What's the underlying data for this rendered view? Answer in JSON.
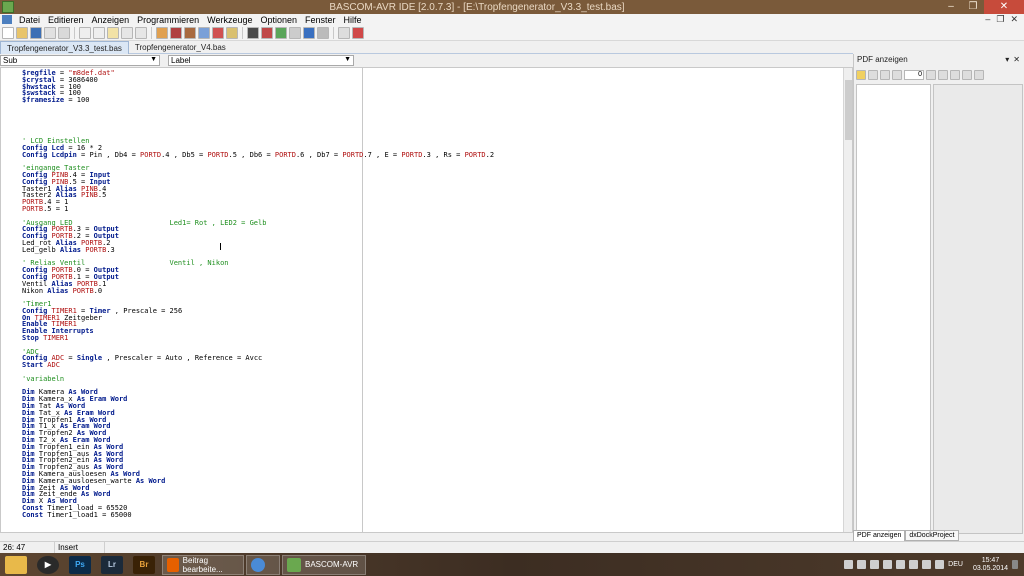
{
  "window": {
    "title": "BASCOM-AVR IDE [2.0.7.3] - [E:\\Tropfengenerator_V3.3_test.bas]",
    "controls": [
      "–",
      "❐",
      "✕"
    ]
  },
  "menu": {
    "items": [
      "Datei",
      "Editieren",
      "Anzeigen",
      "Programmieren",
      "Werkzeuge",
      "Optionen",
      "Fenster",
      "Hilfe"
    ],
    "mdi_controls": [
      "–",
      "❐",
      "✕"
    ]
  },
  "tabs": [
    "Tropfengenerator_V3.3_test.bas",
    "Tropfengenerator_V4.bas"
  ],
  "sub_combo": {
    "label": "Sub"
  },
  "label_combo": {
    "label": "Label"
  },
  "code_lines": [
    [
      [
        "kw",
        "$regfile"
      ],
      [
        "tx",
        " = "
      ],
      [
        "id",
        "\"m8def.dat\""
      ]
    ],
    [
      [
        "kw",
        "$crystal"
      ],
      [
        "tx",
        " = 3686400"
      ]
    ],
    [
      [
        "kw",
        "$hwstack"
      ],
      [
        "tx",
        " = 100"
      ]
    ],
    [
      [
        "kw",
        "$swstack"
      ],
      [
        "tx",
        " = 100"
      ]
    ],
    [
      [
        "kw",
        "$framesize"
      ],
      [
        "tx",
        " = 100"
      ]
    ],
    [],
    [],
    [],
    [],
    [],
    [
      [
        "cm",
        "' LCD Einstellen"
      ]
    ],
    [
      [
        "kw",
        "Config Lcd"
      ],
      [
        "tx",
        " = 16 * 2"
      ]
    ],
    [
      [
        "kw",
        "Config Lcdpin"
      ],
      [
        "tx",
        " = Pin , Db4 = "
      ],
      [
        "id",
        "PORTD"
      ],
      [
        "tx",
        ".4 , Db5 = "
      ],
      [
        "id",
        "PORTD"
      ],
      [
        "tx",
        ".5 , Db6 = "
      ],
      [
        "id",
        "PORTD"
      ],
      [
        "tx",
        ".6 , Db7 = "
      ],
      [
        "id",
        "PORTD"
      ],
      [
        "tx",
        ".7 , E = "
      ],
      [
        "id",
        "PORTD"
      ],
      [
        "tx",
        ".3 , Rs = "
      ],
      [
        "id",
        "PORTD"
      ],
      [
        "tx",
        ".2"
      ]
    ],
    [],
    [
      [
        "cm",
        "'eingange Taster"
      ]
    ],
    [
      [
        "kw",
        "Config"
      ],
      [
        "tx",
        " "
      ],
      [
        "id",
        "PINB"
      ],
      [
        "tx",
        ".4 = "
      ],
      [
        "kw",
        "Input"
      ]
    ],
    [
      [
        "kw",
        "Config"
      ],
      [
        "tx",
        " "
      ],
      [
        "id",
        "PINB"
      ],
      [
        "tx",
        ".5 = "
      ],
      [
        "kw",
        "Input"
      ]
    ],
    [
      [
        "tx",
        "Taster1 "
      ],
      [
        "kw",
        "Alias"
      ],
      [
        "tx",
        " "
      ],
      [
        "id",
        "PINB"
      ],
      [
        "tx",
        ".4"
      ]
    ],
    [
      [
        "tx",
        "Taster2 "
      ],
      [
        "kw",
        "Alias"
      ],
      [
        "tx",
        " "
      ],
      [
        "id",
        "PINB"
      ],
      [
        "tx",
        ".5"
      ]
    ],
    [
      [
        "id",
        "PORTB"
      ],
      [
        "tx",
        ".4 = 1"
      ]
    ],
    [
      [
        "id",
        "PORTB"
      ],
      [
        "tx",
        ".5 = 1"
      ]
    ],
    [],
    [
      [
        "cm",
        "'Ausgang LED                       Led1= Rot , LED2 = Gelb"
      ]
    ],
    [
      [
        "kw",
        "Config"
      ],
      [
        "tx",
        " "
      ],
      [
        "id",
        "PORTB"
      ],
      [
        "tx",
        ".3 = "
      ],
      [
        "kw",
        "Output"
      ]
    ],
    [
      [
        "kw",
        "Config"
      ],
      [
        "tx",
        " "
      ],
      [
        "id",
        "PORTB"
      ],
      [
        "tx",
        ".2 = "
      ],
      [
        "kw",
        "Output"
      ]
    ],
    [
      [
        "tx",
        "Led_rot "
      ],
      [
        "kw",
        "Alias"
      ],
      [
        "tx",
        " "
      ],
      [
        "id",
        "PORTB"
      ],
      [
        "tx",
        ".2"
      ]
    ],
    [
      [
        "tx",
        "Led_gelb "
      ],
      [
        "kw",
        "Alias"
      ],
      [
        "tx",
        " "
      ],
      [
        "id",
        "PORTB"
      ],
      [
        "tx",
        ".3"
      ]
    ],
    [],
    [
      [
        "cm",
        "' Relias Ventil                    Ventil , Nikon"
      ]
    ],
    [
      [
        "kw",
        "Config"
      ],
      [
        "tx",
        " "
      ],
      [
        "id",
        "PORTB"
      ],
      [
        "tx",
        ".0 = "
      ],
      [
        "kw",
        "Output"
      ]
    ],
    [
      [
        "kw",
        "Config"
      ],
      [
        "tx",
        " "
      ],
      [
        "id",
        "PORTB"
      ],
      [
        "tx",
        ".1 = "
      ],
      [
        "kw",
        "Output"
      ]
    ],
    [
      [
        "tx",
        "Ventil "
      ],
      [
        "kw",
        "Alias"
      ],
      [
        "tx",
        " "
      ],
      [
        "id",
        "PORTB"
      ],
      [
        "tx",
        ".1"
      ]
    ],
    [
      [
        "tx",
        "Nikon "
      ],
      [
        "kw",
        "Alias"
      ],
      [
        "tx",
        " "
      ],
      [
        "id",
        "PORTB"
      ],
      [
        "tx",
        ".0"
      ]
    ],
    [],
    [
      [
        "cm",
        "'Timer1"
      ]
    ],
    [
      [
        "kw",
        "Config"
      ],
      [
        "tx",
        " "
      ],
      [
        "id",
        "TIMER1"
      ],
      [
        "tx",
        " = "
      ],
      [
        "kw",
        "Timer"
      ],
      [
        "tx",
        " , Prescale = 256"
      ]
    ],
    [
      [
        "kw",
        "On"
      ],
      [
        "tx",
        " "
      ],
      [
        "id",
        "TIMER1"
      ],
      [
        "tx",
        " Zeitgeber"
      ]
    ],
    [
      [
        "kw",
        "Enable"
      ],
      [
        "tx",
        " "
      ],
      [
        "id",
        "TIMER1"
      ]
    ],
    [
      [
        "kw",
        "Enable Interrupts"
      ]
    ],
    [
      [
        "kw",
        "Stop"
      ],
      [
        "tx",
        " "
      ],
      [
        "id",
        "TIMER1"
      ]
    ],
    [],
    [
      [
        "cm",
        "'ADC"
      ]
    ],
    [
      [
        "kw",
        "Config"
      ],
      [
        "tx",
        " "
      ],
      [
        "id",
        "ADC"
      ],
      [
        "tx",
        " = "
      ],
      [
        "kw",
        "Single"
      ],
      [
        "tx",
        " , Prescaler = Auto , Reference = Avcc"
      ]
    ],
    [
      [
        "kw",
        "Start"
      ],
      [
        "tx",
        " "
      ],
      [
        "id",
        "ADC"
      ]
    ],
    [],
    [
      [
        "cm",
        "'variabeln"
      ]
    ],
    [],
    [
      [
        "kw",
        "Dim"
      ],
      [
        "tx",
        " Kamera "
      ],
      [
        "kw",
        "As Word"
      ]
    ],
    [
      [
        "kw",
        "Dim"
      ],
      [
        "tx",
        " Kamera_x "
      ],
      [
        "kw",
        "As Eram Word"
      ]
    ],
    [
      [
        "kw",
        "Dim"
      ],
      [
        "tx",
        " Tat "
      ],
      [
        "kw",
        "As Word"
      ]
    ],
    [
      [
        "kw",
        "Dim"
      ],
      [
        "tx",
        " Tat_x "
      ],
      [
        "kw",
        "As Eram Word"
      ]
    ],
    [
      [
        "kw",
        "Dim"
      ],
      [
        "tx",
        " Tropfen1 "
      ],
      [
        "kw",
        "As Word"
      ]
    ],
    [
      [
        "kw",
        "Dim"
      ],
      [
        "tx",
        " T1_x "
      ],
      [
        "kw",
        "As Eram Word"
      ]
    ],
    [
      [
        "kw",
        "Dim"
      ],
      [
        "tx",
        " Tropfen2 "
      ],
      [
        "kw",
        "As Word"
      ]
    ],
    [
      [
        "kw",
        "Dim"
      ],
      [
        "tx",
        " T2_x "
      ],
      [
        "kw",
        "As Eram Word"
      ]
    ],
    [
      [
        "kw",
        "Dim"
      ],
      [
        "tx",
        " Tropfen1_ein "
      ],
      [
        "kw",
        "As Word"
      ]
    ],
    [
      [
        "kw",
        "Dim"
      ],
      [
        "tx",
        " Tropfen1_aus "
      ],
      [
        "kw",
        "As Word"
      ]
    ],
    [
      [
        "kw",
        "Dim"
      ],
      [
        "tx",
        " Tropfen2_ein "
      ],
      [
        "kw",
        "As Word"
      ]
    ],
    [
      [
        "kw",
        "Dim"
      ],
      [
        "tx",
        " Tropfen2_aus "
      ],
      [
        "kw",
        "As Word"
      ]
    ],
    [
      [
        "kw",
        "Dim"
      ],
      [
        "tx",
        " Kamera_ausloesen "
      ],
      [
        "kw",
        "As Word"
      ]
    ],
    [
      [
        "kw",
        "Dim"
      ],
      [
        "tx",
        " Kamera_ausloesen_warte "
      ],
      [
        "kw",
        "As Word"
      ]
    ],
    [
      [
        "kw",
        "Dim"
      ],
      [
        "tx",
        " Zeit "
      ],
      [
        "kw",
        "As Word"
      ]
    ],
    [
      [
        "kw",
        "Dim"
      ],
      [
        "tx",
        " Zeit_ende "
      ],
      [
        "kw",
        "As Word"
      ]
    ],
    [
      [
        "kw",
        "Dim"
      ],
      [
        "tx",
        " X "
      ],
      [
        "kw",
        "As Word"
      ]
    ],
    [
      [
        "kw",
        "Const"
      ],
      [
        "tx",
        " Timer1_load = 65520"
      ]
    ],
    [
      [
        "kw",
        "Const"
      ],
      [
        "tx",
        " Timer1_load1 = 65000"
      ]
    ]
  ],
  "right_panel": {
    "title": "PDF anzeigen",
    "page_value": "0",
    "tabs": [
      "PDF anzeigen",
      "dxDockProject"
    ]
  },
  "status": {
    "position": "26: 47",
    "mode": "Insert"
  },
  "taskbar": {
    "apps": [
      {
        "name": "file-explorer",
        "color": "#e8b94a",
        "glyph": ""
      },
      {
        "name": "media-player",
        "color": "#2a2a2a",
        "glyph": "▶"
      },
      {
        "name": "photoshop",
        "color": "#0b2a48",
        "glyph": "Ps"
      },
      {
        "name": "lightroom",
        "color": "#1b2a3a",
        "glyph": "Lr"
      },
      {
        "name": "bridge",
        "color": "#3a2206",
        "glyph": "Br"
      }
    ],
    "buttons": [
      {
        "label": "Beitrag bearbeite...",
        "color": "#e66000"
      },
      {
        "label": "",
        "color": "#4a8bd6"
      },
      {
        "label": "BASCOM-AVR",
        "color": "#6aa84f"
      }
    ],
    "time": "15:47",
    "date": "03.05.2014",
    "lang": "DEU"
  }
}
